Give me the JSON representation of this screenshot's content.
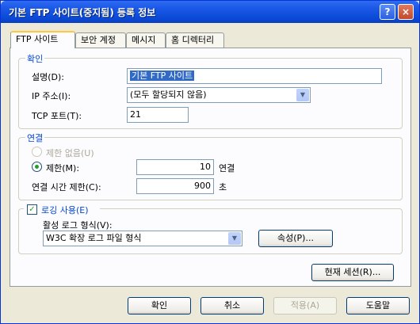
{
  "window": {
    "title": "기본 FTP 사이트(중지됨) 등록 정보",
    "help_icon": "?",
    "close_icon": "×"
  },
  "tabs": [
    {
      "label": "FTP 사이트",
      "active": true
    },
    {
      "label": "보안 계정"
    },
    {
      "label": "메시지"
    },
    {
      "label": "홈 디렉터리"
    }
  ],
  "identification": {
    "legend": "확인",
    "description_label": "설명(D):",
    "description_value": "기본 FTP 사이트",
    "ip_label": "IP 주소(I):",
    "ip_value": "(모두 할당되지 않음)",
    "port_label": "TCP 포트(T):",
    "port_value": "21"
  },
  "connection": {
    "legend": "연결",
    "unlimited_label": "제한 없음(U)",
    "limited_label": "제한(M):",
    "limited_value": "10",
    "limited_unit": "연결",
    "timeout_label": "연결 시간 제한(C):",
    "timeout_value": "900",
    "timeout_unit": "초"
  },
  "logging": {
    "enable_label": "로깅 사용(E)",
    "enabled": true,
    "format_label": "활성 로그 형식(V):",
    "format_value": "W3C 확장 로그 파일 형식",
    "properties_button": "속성(P)..."
  },
  "current_sessions_button": "현재 세션(R)...",
  "footer": {
    "ok": "확인",
    "cancel": "취소",
    "apply": "적용(A)",
    "help": "도움말"
  }
}
